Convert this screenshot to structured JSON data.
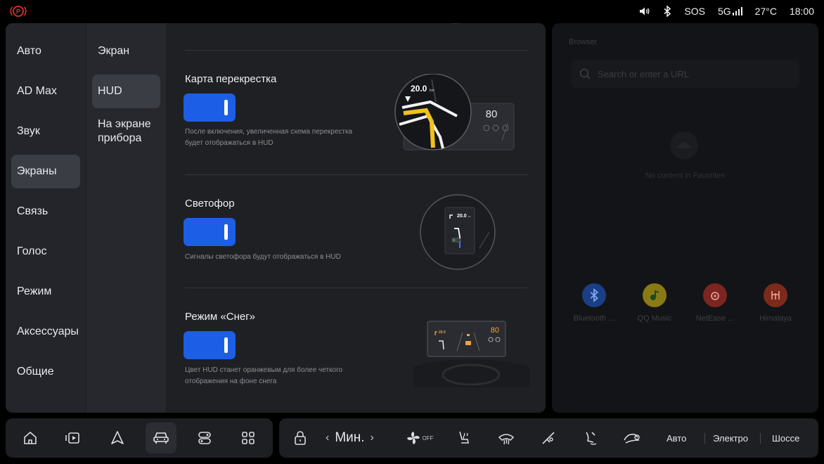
{
  "status": {
    "sos": "SOS",
    "network": "5G",
    "temperature": "27°C",
    "time": "18:00"
  },
  "nav_primary": [
    {
      "label": "Авто",
      "active": false
    },
    {
      "label": "AD Max",
      "active": false
    },
    {
      "label": "Звук",
      "active": false
    },
    {
      "label": "Экраны",
      "active": true
    },
    {
      "label": "Связь",
      "active": false
    },
    {
      "label": "Голос",
      "active": false
    },
    {
      "label": "Режим",
      "active": false
    },
    {
      "label": "Аксессуары",
      "active": false
    },
    {
      "label": "Общие",
      "active": false
    }
  ],
  "nav_secondary": [
    {
      "label": "Экран",
      "active": false
    },
    {
      "label": "HUD",
      "active": true
    },
    {
      "label": "На экране прибора",
      "active": false
    }
  ],
  "settings": [
    {
      "title": "Карта перекрестка",
      "enabled": true,
      "description": "После включения, увеличенная схема перекрестка будет отображаться в HUD",
      "preview": {
        "distance": "20.0",
        "distance_unit": "km",
        "speed": "80"
      }
    },
    {
      "title": "Светофор",
      "enabled": true,
      "description": "Сигналы светофора будут отображаться в HUD",
      "preview": {
        "distance": "20.0",
        "distance_unit": "km"
      }
    },
    {
      "title": "Режим «Снег»",
      "enabled": true,
      "description": "Цвет HUD станет оранжевым для более четкого отображения на фоне снега",
      "preview": {
        "distance": "20.0",
        "speed": "80"
      }
    }
  ],
  "browser": {
    "title": "Browser",
    "search_placeholder": "Search or enter a URL",
    "empty_text": "No content in Favorites",
    "apps": [
      {
        "label": "Bluetooth ...",
        "icon": "bluetooth-icon",
        "color": "#1f5fd6"
      },
      {
        "label": "QQ Music",
        "icon": "qq-music-icon",
        "color": "#e8c21c"
      },
      {
        "label": "NetEase ...",
        "icon": "netease-music-icon",
        "color": "#d8342c"
      },
      {
        "label": "Himalaya",
        "icon": "himalaya-icon",
        "color": "#e2452c"
      }
    ]
  },
  "dock": {
    "apps": [
      "home-icon",
      "media-icon",
      "navigation-icon",
      "car-icon",
      "apps-switch-icon",
      "all-apps-icon"
    ],
    "temperature": "Мин.",
    "fan": "OFF",
    "modes": [
      "Авто",
      "Электро",
      "Шоссе"
    ]
  },
  "colors": {
    "accent": "#1d5ee6",
    "panel": "#26282d",
    "content": "#1f2024",
    "hud_orange": "#f0a23a"
  }
}
